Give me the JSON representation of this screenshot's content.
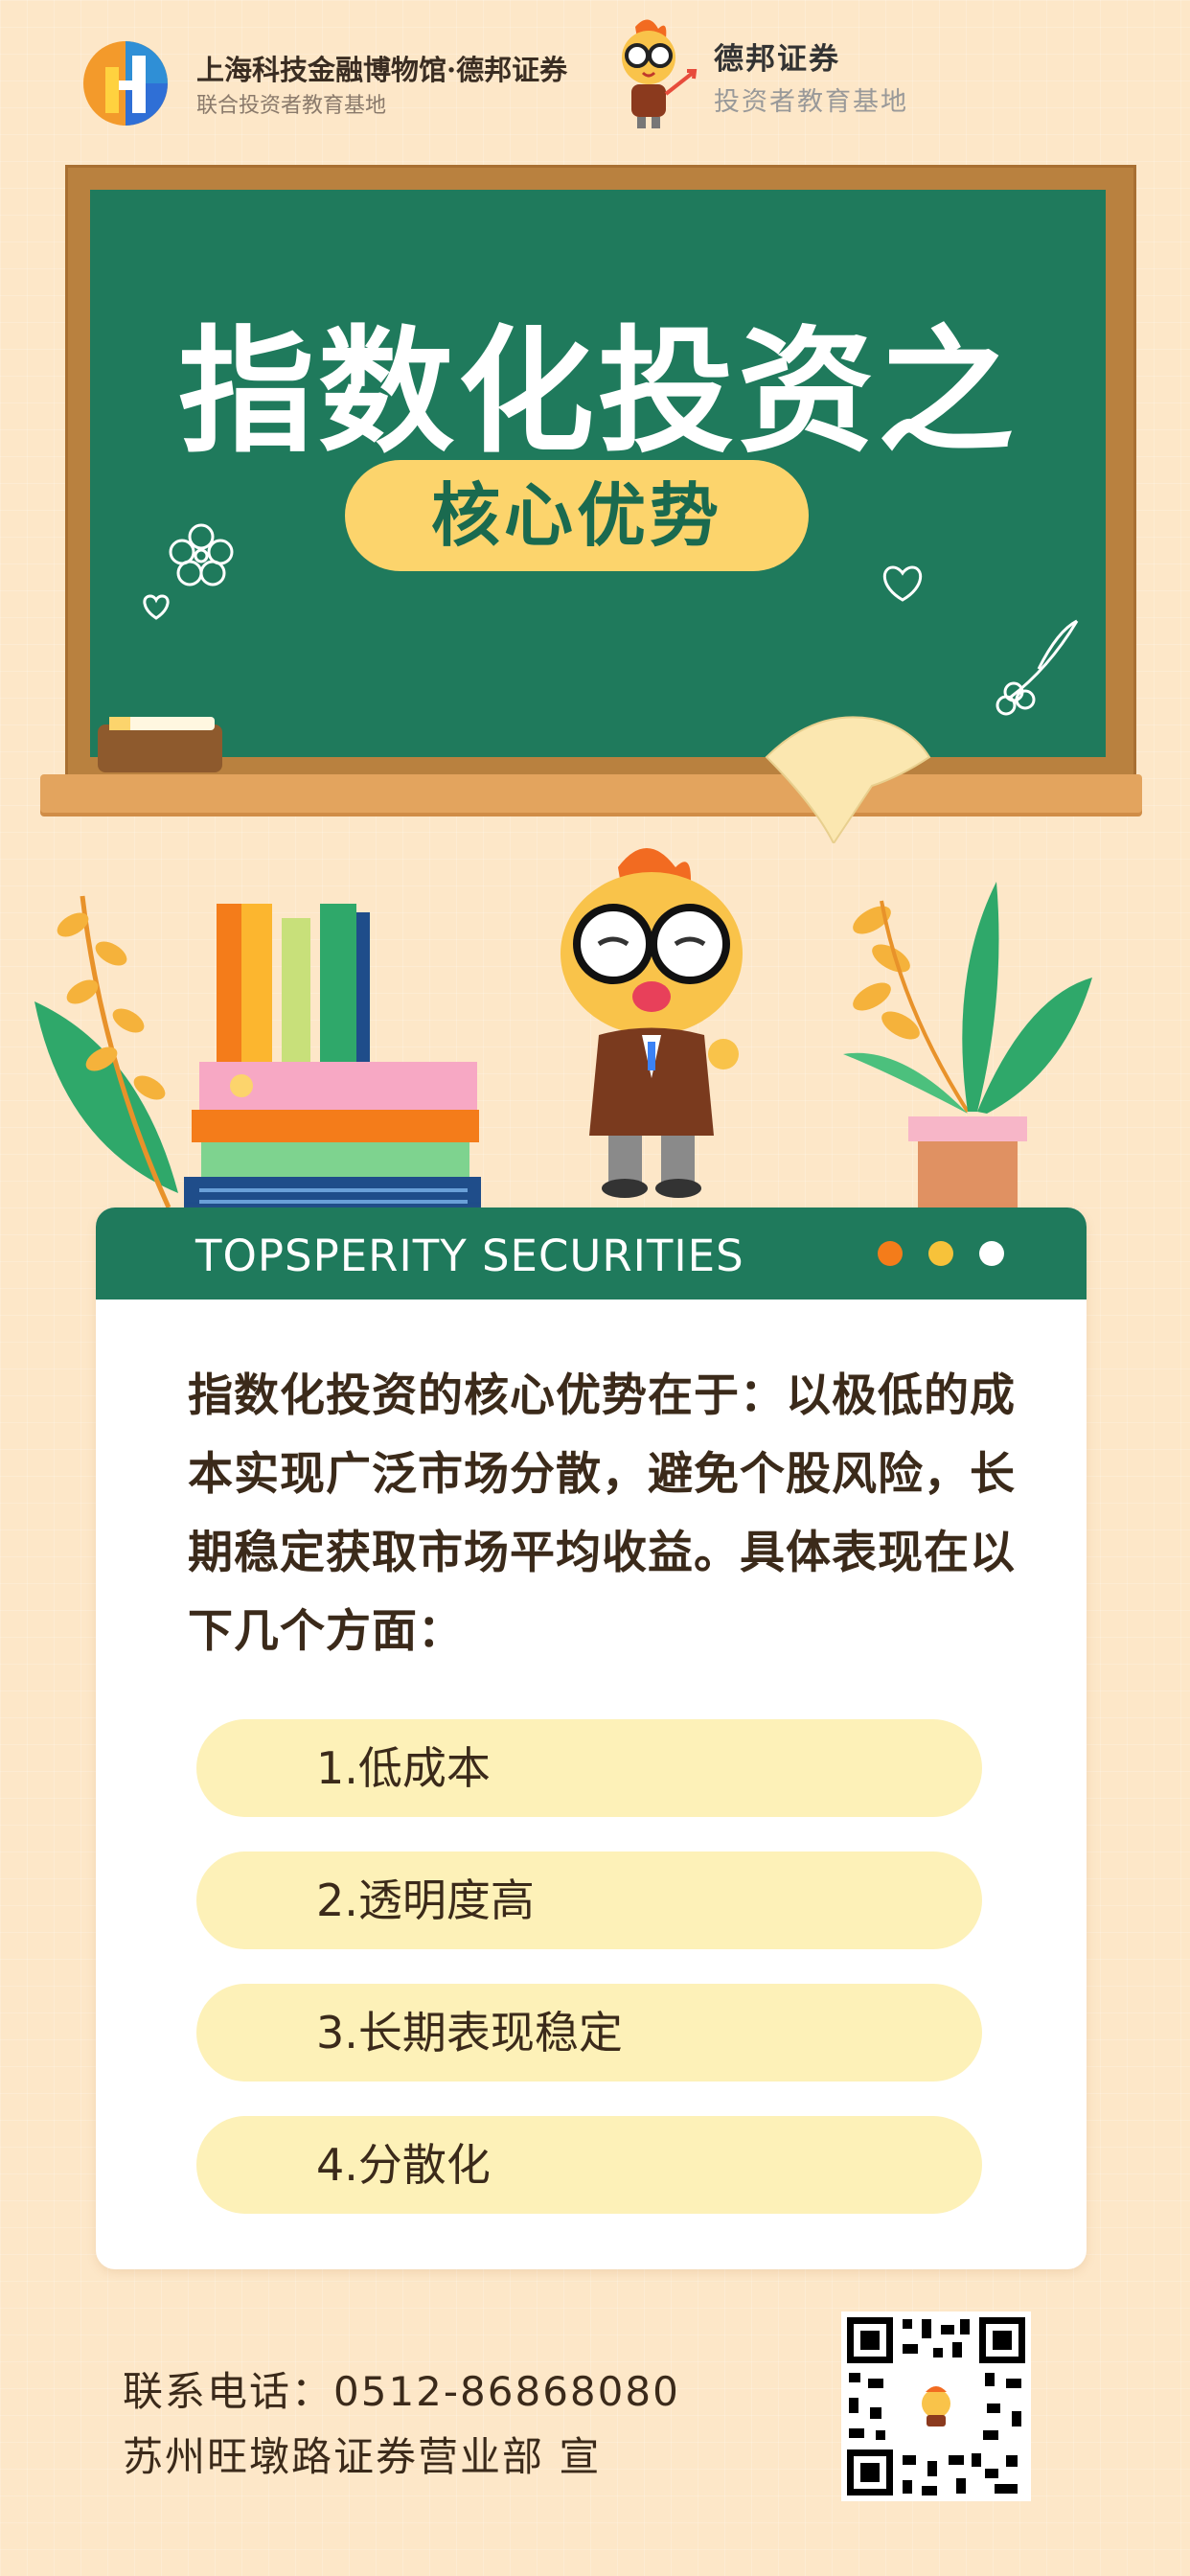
{
  "header": {
    "museum_title": "上海科技金融博物馆·德邦证券",
    "museum_subtitle": "联合投资者教育基地",
    "brand_name": "德邦证券",
    "brand_subtitle": "投资者教育基地"
  },
  "board": {
    "title": "指数化投资之",
    "pill": "核心优势"
  },
  "card": {
    "bar_title": "TOPSPERITY SECURITIES",
    "dot_colors": [
      "#f47c1a",
      "#f7c23a",
      "#ffffff"
    ],
    "paragraph": "指数化投资的核心优势在于：以极低的成本实现广泛市场分散，避免个股风险，长期稳定获取市场平均收益。具体表现在以下几个方面：",
    "items": [
      "1.低成本",
      "2.透明度高",
      "3.长期表现稳定",
      "4.分散化"
    ]
  },
  "footer": {
    "phone": "联系电话：0512-86868080",
    "branch": "苏州旺墩路证券营业部  宣"
  },
  "colors": {
    "background": "#fde7c8",
    "board_green": "#1f7a5c",
    "pill_yellow": "#fcd46c",
    "item_fill": "#fdf1b8"
  }
}
